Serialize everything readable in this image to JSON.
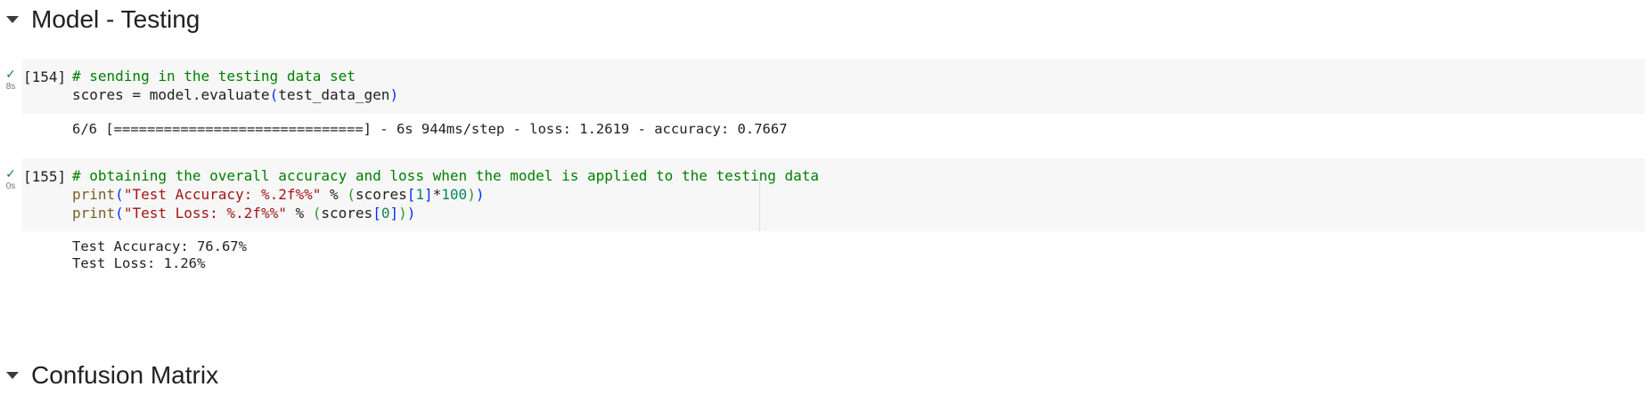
{
  "sections": {
    "testing_title": "Model - Testing",
    "confusion_title": "Confusion Matrix"
  },
  "cell1": {
    "status": "✓",
    "exec_time": "8s",
    "exec_count": "[154]",
    "code": {
      "line1_comment": "# sending in the testing data set",
      "line2_a": "scores = model.evaluate",
      "line2_paren_open": "(",
      "line2_arg": "test_data_gen",
      "line2_paren_close": ")"
    },
    "output": "6/6 [==============================] - 6s 944ms/step - loss: 1.2619 - accuracy: 0.7667"
  },
  "cell2": {
    "status": "✓",
    "exec_time": "0s",
    "exec_count": "[155]",
    "code": {
      "line1_comment": "# obtaining the overall accuracy and loss when the model is applied to the testing data",
      "line2_fn": "print",
      "line2_open": "(",
      "line2_str": "\"Test Accuracy: %.2f%%\"",
      "line2_op": " % ",
      "line2_open2": "(",
      "line2_var": "scores",
      "line2_idx_open": "[",
      "line2_idx": "1",
      "line2_idx_close": "]",
      "line2_mul": "*",
      "line2_num": "100",
      "line2_close2": ")",
      "line2_close": ")",
      "line3_fn": "print",
      "line3_open": "(",
      "line3_str": "\"Test Loss: %.2f%%\"",
      "line3_op": " % ",
      "line3_open2": "(",
      "line3_var": "scores",
      "line3_idx_open": "[",
      "line3_idx": "0",
      "line3_idx_close": "]",
      "line3_close2": ")",
      "line3_close": ")"
    },
    "output_line1": "Test Accuracy: 76.67%",
    "output_line2": "Test Loss: 1.26%"
  },
  "colors": {
    "comment": "#008000",
    "string": "#a31515",
    "function": "#795e26",
    "number": "#098658",
    "check": "#188038",
    "cell_bg": "#f7f7f7"
  }
}
